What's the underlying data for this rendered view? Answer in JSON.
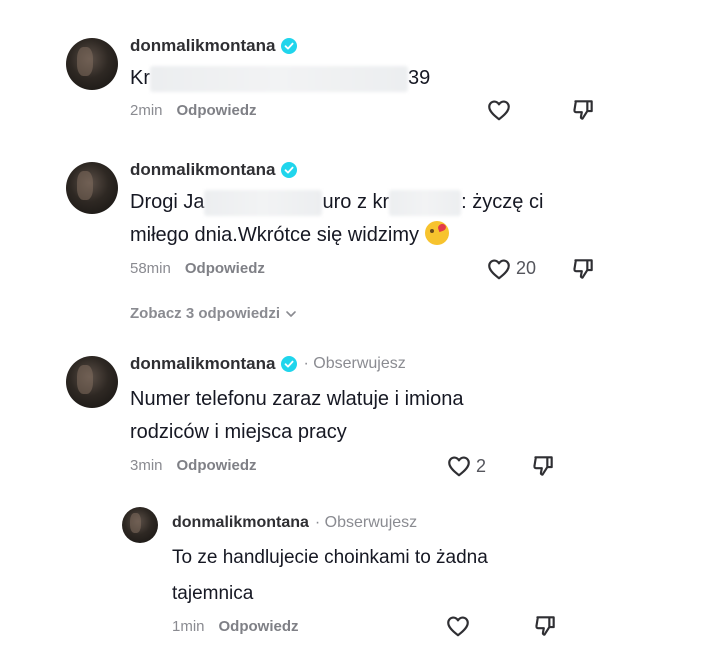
{
  "comments": [
    {
      "username": "donmalikmontana",
      "text_before": "Kr",
      "text_after": "39",
      "time": "2min",
      "reply": "Odpowiedz",
      "likes": ""
    },
    {
      "username": "donmalikmontana",
      "line1_a": "Drogi Ja",
      "line1_b": "uro z kr",
      "line1_c": ": życzę ci",
      "line2": "miłego dnia.Wkrótce się widzimy",
      "time": "58min",
      "reply": "Odpowiedz",
      "likes": "20"
    },
    {
      "username": "donmalikmontana",
      "following": "· Obserwujesz",
      "line1": "Numer telefonu zaraz wlatuje i imiona",
      "line2": "rodziców i miejsca pracy",
      "time": "3min",
      "reply": "Odpowiedz",
      "likes": "2"
    },
    {
      "username": "donmalikmontana",
      "following": "· Obserwujesz",
      "line1": "To ze handlujecie choinkami to żadna",
      "line2": "tajemnica",
      "time": "1min",
      "reply": "Odpowiedz",
      "likes": ""
    }
  ],
  "view_replies": "Zobacz 3 odpowiedzi",
  "icons": {
    "verified": "verified-badge-icon",
    "like": "heart-outline-icon",
    "dislike": "thumbs-down-icon",
    "chevron": "chevron-down-icon"
  },
  "colors": {
    "verified": "#20d5ec",
    "text": "#161823",
    "muted": "#8a8b91"
  }
}
